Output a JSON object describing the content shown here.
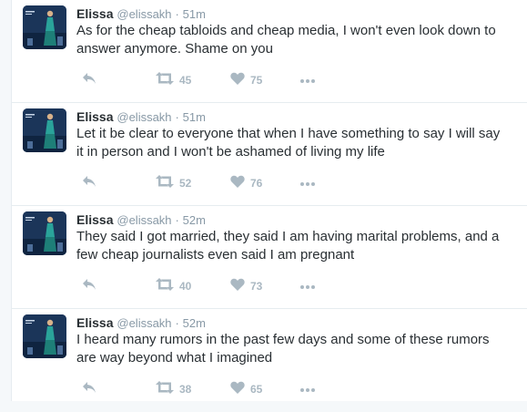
{
  "tweets": [
    {
      "name": "Elissa",
      "handle": "@elissakh",
      "separator": "·",
      "time": "51m",
      "lines": [
        "As for the cheap tabloids and cheap media, I won't even look down to",
        "answer anymore. Shame on you"
      ],
      "retweets": "45",
      "likes": "75"
    },
    {
      "name": "Elissa",
      "handle": "@elissakh",
      "separator": "·",
      "time": "51m",
      "lines": [
        "Let it be clear to everyone that when I have something to say I will say",
        "it in person and I won't be ashamed of living my life"
      ],
      "retweets": "52",
      "likes": "76"
    },
    {
      "name": "Elissa",
      "handle": "@elissakh",
      "separator": "·",
      "time": "52m",
      "lines": [
        "They said I got married, they said I am having marital problems, and a",
        "few cheap journalists even said I am pregnant"
      ],
      "retweets": "40",
      "likes": "73"
    },
    {
      "name": "Elissa",
      "handle": "@elissakh",
      "separator": "·",
      "time": "52m",
      "lines": [
        "I heard many rumors in the past few days and some of these rumors",
        "are way beyond what I imagined"
      ],
      "retweets": "38",
      "likes": "65"
    }
  ],
  "icons": {
    "reply": "reply-icon",
    "retweet": "retweet-icon",
    "like": "heart-icon",
    "more": "more-icon"
  },
  "colors": {
    "name": "#292f33",
    "meta": "#8899a6",
    "action": "#aab8c2",
    "divider": "#e6ecf0"
  }
}
